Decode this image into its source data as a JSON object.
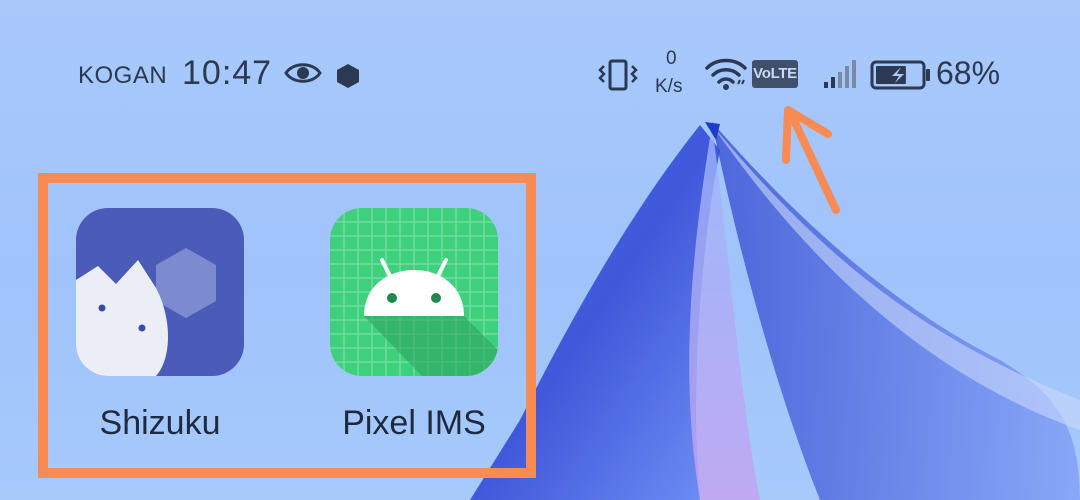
{
  "status_bar": {
    "carrier": "KOGAN",
    "time": "10:47",
    "net_speed_value": "0",
    "net_speed_unit": "K/s",
    "volte_label": "VoLTE",
    "battery_percent": "68%",
    "battery_level": 0.68,
    "icons": [
      "eye-icon",
      "hexagon-notification-icon",
      "vibrate-icon",
      "wifi-icon",
      "volte-icon",
      "cell-signal-icon",
      "battery-charging-icon"
    ]
  },
  "apps": [
    {
      "label": "Shizuku",
      "icon": "shizuku-app-icon",
      "color": "#4a5bb8"
    },
    {
      "label": "Pixel IMS",
      "icon": "android-app-icon",
      "color": "#3ed07c"
    }
  ],
  "annotations": {
    "highlight_color": "#f88a54",
    "arrow_target": "volte-icon"
  }
}
